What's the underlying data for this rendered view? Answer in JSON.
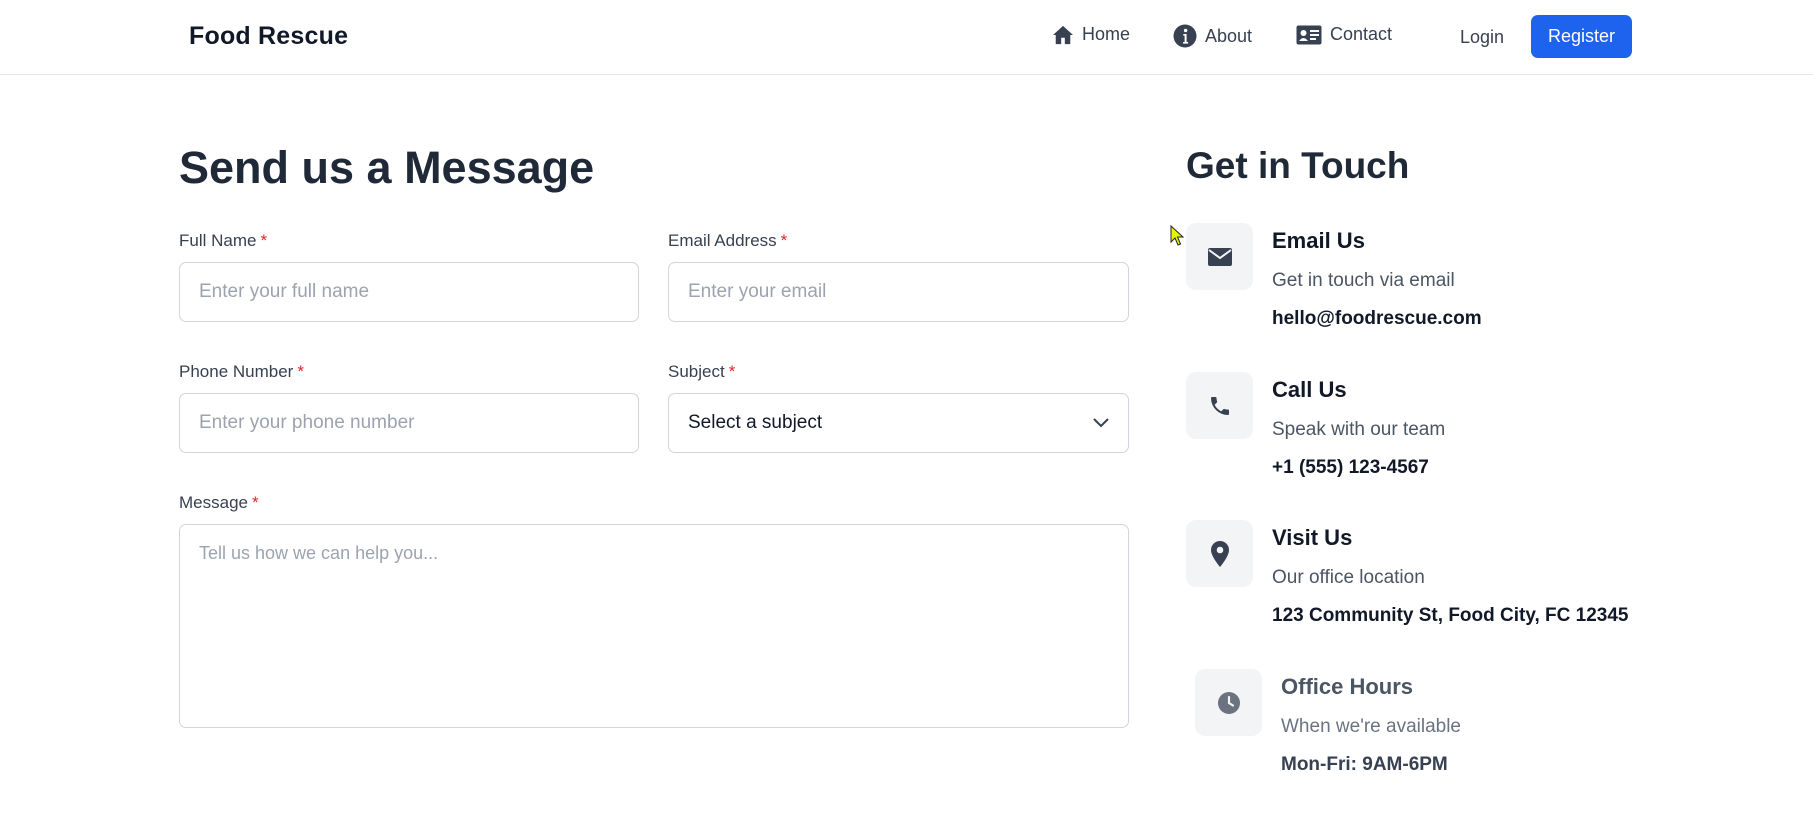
{
  "header": {
    "brand": "Food Rescue",
    "nav": [
      {
        "label": "Home",
        "icon": "home-icon"
      },
      {
        "label": "About",
        "icon": "info-icon"
      },
      {
        "label": "Contact",
        "icon": "contact-card-icon"
      }
    ],
    "login_label": "Login",
    "register_label": "Register"
  },
  "form": {
    "title": "Send us a Message",
    "required_mark": "*",
    "full_name": {
      "label": "Full Name",
      "placeholder": "Enter your full name",
      "value": ""
    },
    "email": {
      "label": "Email Address",
      "placeholder": "Enter your email",
      "value": ""
    },
    "phone": {
      "label": "Phone Number",
      "placeholder": "Enter your phone number",
      "value": ""
    },
    "subject": {
      "label": "Subject",
      "selected": "Select a subject"
    },
    "message": {
      "label": "Message",
      "placeholder": "Tell us how we can help you...",
      "value": ""
    }
  },
  "contact": {
    "title": "Get in Touch",
    "items": [
      {
        "icon": "envelope-icon",
        "heading": "Email Us",
        "sub": "Get in touch via email",
        "value": "hello@foodrescue.com"
      },
      {
        "icon": "phone-icon",
        "heading": "Call Us",
        "sub": "Speak with our team",
        "value": "+1 (555) 123-4567"
      },
      {
        "icon": "map-pin-icon",
        "heading": "Visit Us",
        "sub": "Our office location",
        "value": "123 Community St, Food City, FC 12345"
      },
      {
        "icon": "clock-icon",
        "heading": "Office Hours",
        "sub": "When we're available",
        "value": "Mon-Fri: 9AM-6PM"
      }
    ]
  },
  "colors": {
    "accent": "#1d63ed",
    "required": "#dc2626",
    "icon_bg": "#f3f4f6",
    "icon_fg": "#374151"
  }
}
